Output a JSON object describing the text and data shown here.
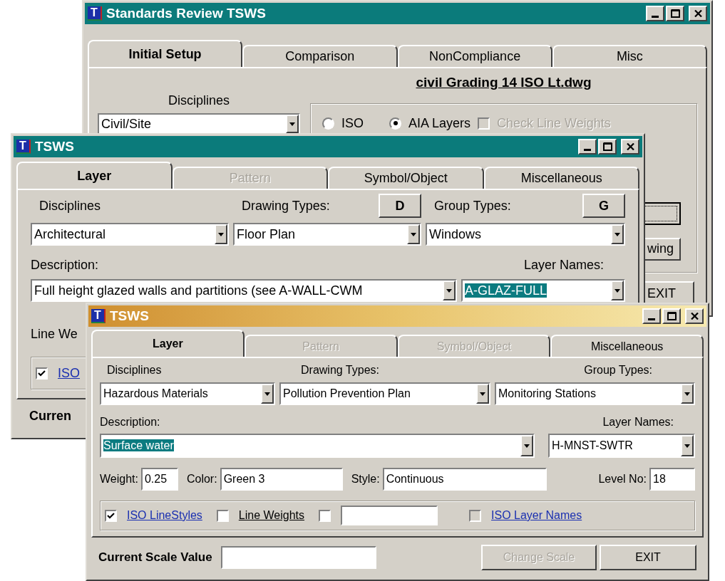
{
  "main_window": {
    "title": "Standards Review TSWS",
    "logo_letter": "T",
    "tabs": [
      {
        "label": "Initial Setup",
        "selected": true,
        "disabled": false
      },
      {
        "label": "Comparison",
        "selected": false,
        "disabled": false
      },
      {
        "label": "NonCompliance",
        "selected": false,
        "disabled": false
      },
      {
        "label": "Misc",
        "selected": false,
        "disabled": false
      }
    ],
    "file_name": "civil Grading 14 ISO Lt.dwg",
    "dropdowns": [
      {
        "label": "Disciplines",
        "value": "Civil/Site"
      }
    ],
    "layer_standard": [
      {
        "label": "ISO",
        "selected": false
      },
      {
        "label": "AIA Layers",
        "selected": true
      }
    ],
    "check_line_weights": {
      "label": "Check Line Weights",
      "checked": false,
      "disabled": true
    },
    "buttons": [
      {
        "label": "wing"
      },
      {
        "label": "EXIT"
      }
    ]
  },
  "layer_window": {
    "title": "TSWS",
    "logo_letter": "T",
    "tabs": [
      {
        "label": "Layer",
        "selected": true,
        "disabled": false
      },
      {
        "label": "Pattern",
        "selected": false,
        "disabled": true
      },
      {
        "label": "Symbol/Object",
        "selected": false,
        "disabled": false
      },
      {
        "label": "Miscellaneous",
        "selected": false,
        "disabled": false
      }
    ],
    "dropdowns": [
      {
        "label": "Disciplines",
        "value": "Architectural"
      },
      {
        "label": "Drawing Types:",
        "value": "Floor Plan",
        "letter_button": "D"
      },
      {
        "label": "Group Types:",
        "value": "Windows",
        "letter_button": "G"
      }
    ],
    "description": {
      "label": "Description:",
      "value": "Full height glazed walls and partitions (see A-WALL-CWM",
      "highlighted": false
    },
    "layer_names": {
      "label": "Layer Names:",
      "value": "A-GLAZ-FULL",
      "highlighted": true
    },
    "line_weight_label": "Line We",
    "options": [
      {
        "kind": "link",
        "label": "ISO",
        "checked": true,
        "disabled": false
      }
    ],
    "scale": {
      "label": "Curren"
    }
  },
  "front_window": {
    "title": "TSWS",
    "logo_letter": "T",
    "tabs": [
      {
        "label": "Layer",
        "selected": true,
        "disabled": false
      },
      {
        "label": "Pattern",
        "selected": false,
        "disabled": true
      },
      {
        "label": "Symbol/Object",
        "selected": false,
        "disabled": true
      },
      {
        "label": "Miscellaneous",
        "selected": false,
        "disabled": false
      }
    ],
    "dropdowns": [
      {
        "label": "Disciplines",
        "value": "Hazardous Materials"
      },
      {
        "label": "Drawing Types:",
        "value": "Pollution Prevention Plan"
      },
      {
        "label": "Group Types:",
        "value": "Monitoring Stations"
      }
    ],
    "description": {
      "label": "Description:",
      "value": "Surface water",
      "highlighted": true
    },
    "layer_names": {
      "label": "Layer Names:",
      "value": "H-MNST-SWTR",
      "highlighted": false
    },
    "properties": [
      {
        "label": "Weight:",
        "value": "0.25"
      },
      {
        "label": "Color:",
        "value": "Green 3"
      },
      {
        "label": "Style:",
        "value": "Continuous"
      },
      {
        "label": "Level No:",
        "value": "18"
      }
    ],
    "options": [
      {
        "kind": "link",
        "label": "ISO LineStyles",
        "checked": true,
        "disabled": false
      },
      {
        "kind": "text",
        "label": "Line Weights",
        "checked": false,
        "disabled": false
      },
      {
        "kind": "field",
        "checked": false,
        "disabled": false
      },
      {
        "kind": "link",
        "label": "ISO Layer Names",
        "checked": false,
        "disabled": true
      }
    ],
    "scale": {
      "label": "Current Scale Value"
    },
    "buttons": [
      {
        "label": "Change Scale",
        "disabled": true
      },
      {
        "label": "EXIT",
        "disabled": false
      }
    ]
  }
}
